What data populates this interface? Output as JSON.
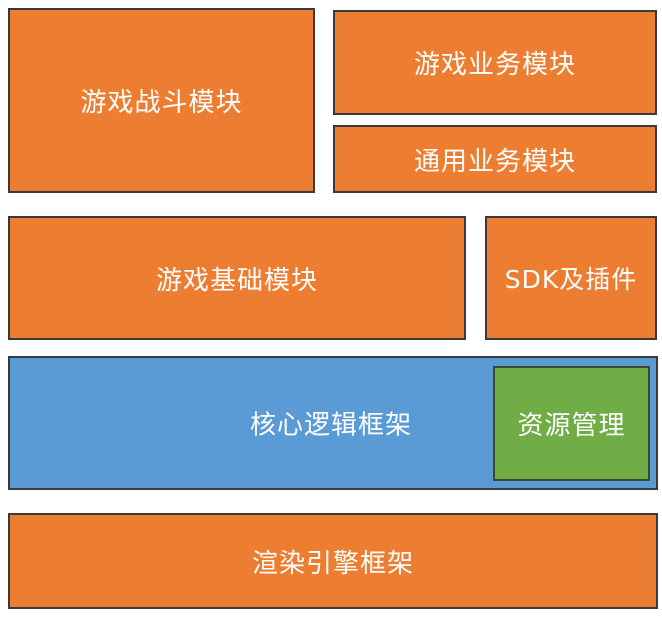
{
  "blocks": {
    "battle": "游戏战斗模块",
    "business": "游戏业务模块",
    "common": "通用业务模块",
    "base": "游戏基础模块",
    "sdk": "SDK及插件",
    "core": "核心逻辑框架",
    "resource": "资源管理",
    "render": "渲染引擎框架"
  },
  "colors": {
    "orange": "#ed7d31",
    "blue": "#5b9bd5",
    "green": "#70ad47"
  }
}
